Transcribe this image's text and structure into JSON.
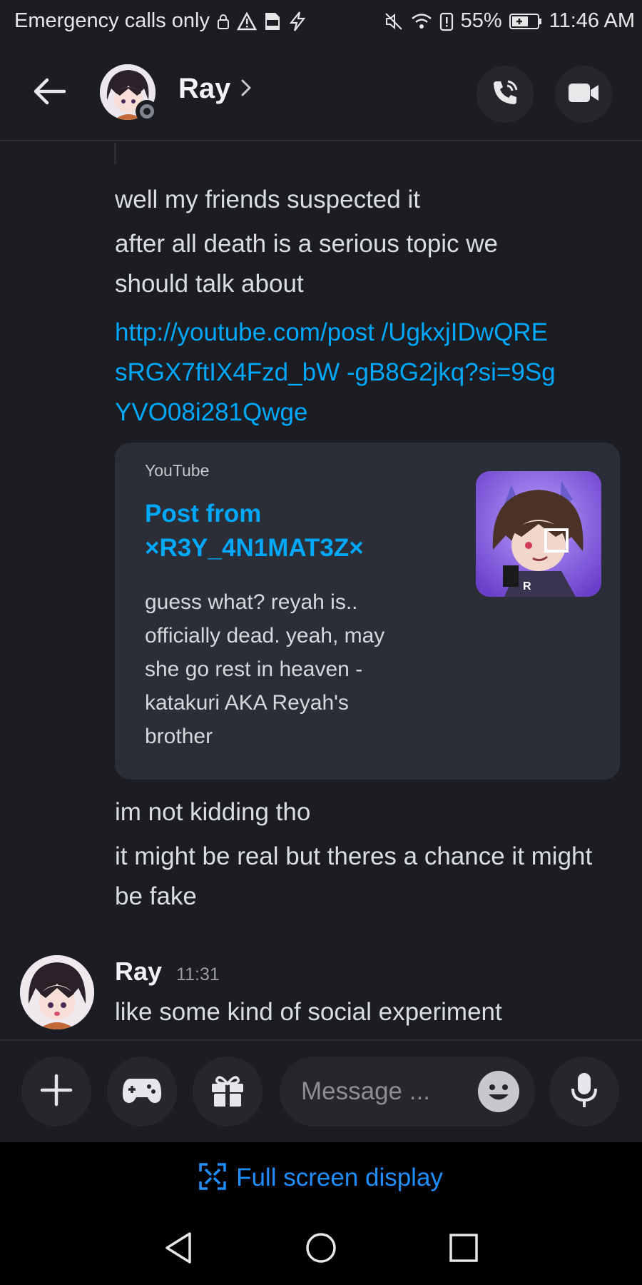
{
  "status_bar": {
    "carrier": "Emergency calls only",
    "battery": "55%",
    "time": "11:46 AM"
  },
  "header": {
    "name": "Ray",
    "chevron": "›"
  },
  "messages": {
    "m1": "well my friends suspected it",
    "m2": "after all death is a serious topic we should talk about",
    "link": "http://youtube.com/post /UgkxjIDwQREsRGX7ftIX4Fzd_bW -gB8G2jkq?si=9SgYVO08i281Qwge",
    "embed": {
      "provider": "YouTube",
      "title": "Post from ×R3Y_4N1MAT3Z×",
      "description": "guess what? reyah is.. officially dead. yeah, may she go rest in heaven -katakuri AKA Reyah's brother",
      "thumb_label": "R"
    },
    "m3": "im not kidding tho",
    "m4": "it might be real but theres a chance it might be fake",
    "group2": {
      "author": "Ray",
      "time": "11:31",
      "text": "like some kind of social experiment"
    }
  },
  "composer": {
    "placeholder": "Message ..."
  },
  "fullscreen": {
    "label": "Full screen display"
  },
  "colors": {
    "background": "#1c1d22",
    "link": "#00a8fc",
    "embed_bg": "#2b2d37",
    "fullscreen_text": "#1f8fff"
  },
  "icons": {
    "header": [
      "back-arrow-icon",
      "call-icon",
      "video-camera-icon"
    ],
    "composer": [
      "plus-icon",
      "gamepad-icon",
      "gift-icon",
      "emoji-icon",
      "microphone-icon"
    ],
    "nav": [
      "nav-back-icon",
      "nav-home-icon",
      "nav-recents-icon"
    ]
  }
}
